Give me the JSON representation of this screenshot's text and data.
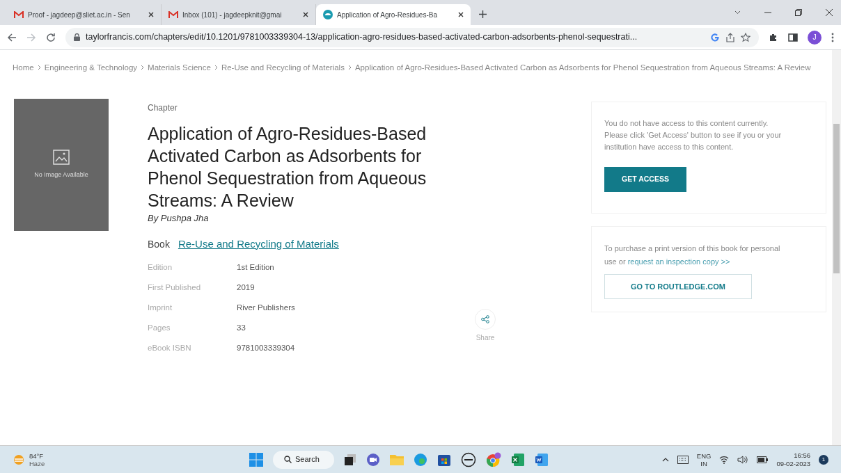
{
  "browser": {
    "tabs": [
      {
        "title": "Proof - jagdeep@sliet.ac.in - Sen",
        "kind": "mail",
        "selected": false
      },
      {
        "title": "Inbox (101) - jagdeepknit@gmai",
        "kind": "mail",
        "selected": false
      },
      {
        "title": "Application of Agro-Residues-Ba",
        "kind": "site",
        "selected": true
      }
    ],
    "address": "taylorfrancis.com/chapters/edit/10.1201/9781003339304-13/application-agro-residues-based-activated-carbon-adsorbents-phenol-sequestrati...",
    "profile_initial": "J"
  },
  "breadcrumb": [
    "Home",
    "Engineering & Technology",
    "Materials Science",
    "Re-Use and Recycling of Materials",
    "Application of Agro-Residues-Based Activated Carbon as Adsorbents for Phenol Sequestration from Aqueous Streams: A Review"
  ],
  "cover": {
    "caption": "No Image Available"
  },
  "chapter": {
    "type_label": "Chapter",
    "title": "Application of Agro-Residues-Based Activated Carbon as Adsorbents for Phenol Sequestration from Aqueous Streams: A Review",
    "author": "By Pushpa Jha",
    "book_label": "Book",
    "book_title": "Re-Use and Recycling of Materials",
    "details": [
      {
        "label": "Edition",
        "value": "1st Edition"
      },
      {
        "label": "First Published",
        "value": "2019"
      },
      {
        "label": "Imprint",
        "value": "River Publishers"
      },
      {
        "label": "Pages",
        "value": "33"
      },
      {
        "label": "eBook ISBN",
        "value": "9781003339304"
      }
    ]
  },
  "share": {
    "label": "Share"
  },
  "access_panel": {
    "message": "You do not have access to this content currently. Please click 'Get Access' button to see if you or your institution have access to this content.",
    "button": "GET ACCESS"
  },
  "purchase_panel": {
    "message": "To purchase a print version of this book for personal use or",
    "link": "request an inspection copy >>",
    "button": "GO TO ROUTLEDGE.COM"
  },
  "taskbar": {
    "temperature": "84°F",
    "condition": "Haze",
    "search": "Search",
    "language": "ENG",
    "region": "IN",
    "time": "16:56",
    "date": "09-02-2023",
    "notifications": "1"
  }
}
